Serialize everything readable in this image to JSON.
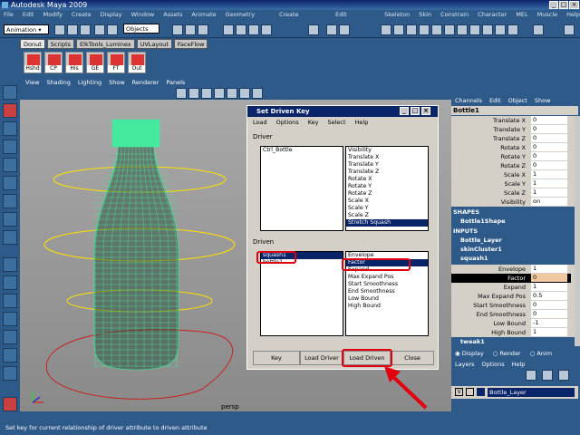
{
  "title": "Autodesk Maya 2009",
  "menubar": [
    "File",
    "Edit",
    "Modify",
    "Create",
    "Display",
    "Window",
    "Assets",
    "Animate",
    "Geometry Cache",
    "Create Deformers",
    "Edit Deformers",
    "Skeleton",
    "Skin",
    "Constrain",
    "Character",
    "MEL",
    "Muscle",
    "Help"
  ],
  "mode_select": "Animation",
  "objects_field": "Objects",
  "shelf_tabs": [
    "Donut",
    "Scripts",
    "ElkTools_Luminex",
    "UVLayout",
    "FaceFlow"
  ],
  "shelf_buttons": [
    "Hshd",
    "CP",
    "His",
    "GE",
    "FT",
    "Out"
  ],
  "panel_menu": [
    "View",
    "Shading",
    "Lighting",
    "Show",
    "Renderer",
    "Panels"
  ],
  "viewport": {
    "camera_label": "persp"
  },
  "dialog": {
    "title": "Set Driven Key",
    "menu": [
      "Load",
      "Options",
      "Key",
      "Select",
      "Help"
    ],
    "driver_label": "Driver",
    "driver_objects": [
      "Ctrl_Bottle"
    ],
    "driver_attributes": [
      "Visibility",
      "Translate X",
      "Translate Y",
      "Translate Z",
      "Rotate X",
      "Rotate Y",
      "Rotate Z",
      "Scale X",
      "Scale Y",
      "Scale Z",
      "Stretch Squash"
    ],
    "driver_selected": "Stretch Squash",
    "driven_label": "Driven",
    "driven_objects": [
      "squash1",
      "bottle1"
    ],
    "driven_selected_object": "squash1",
    "driven_attributes": [
      "Envelope",
      "Factor",
      "Expand",
      "Max Expand Pos",
      "Start Smoothness",
      "End Smoothness",
      "Low Bound",
      "High Bound"
    ],
    "driven_selected": "Factor",
    "buttons": {
      "key": "Key",
      "load_driver": "Load Driver",
      "load_driven": "Load Driven",
      "close": "Close"
    }
  },
  "channel_box": {
    "menu": [
      "Channels",
      "Edit",
      "Object",
      "Show"
    ],
    "object": "Bottle1",
    "channels": [
      {
        "name": "Translate X",
        "value": "0"
      },
      {
        "name": "Translate Y",
        "value": "0"
      },
      {
        "name": "Translate Z",
        "value": "0"
      },
      {
        "name": "Rotate X",
        "value": "0"
      },
      {
        "name": "Rotate Y",
        "value": "0"
      },
      {
        "name": "Rotate Z",
        "value": "0"
      },
      {
        "name": "Scale X",
        "value": "1"
      },
      {
        "name": "Scale Y",
        "value": "1"
      },
      {
        "name": "Scale Z",
        "value": "1"
      },
      {
        "name": "Visibility",
        "value": "on"
      }
    ],
    "shapes_label": "SHAPES",
    "shape": "Bottle1Shape",
    "inputs_label": "INPUTS",
    "inputs": [
      "Bottle_Layer",
      "skinCluster1",
      "squash1"
    ],
    "squash_channels": [
      {
        "name": "Envelope",
        "value": "1"
      },
      {
        "name": "Factor",
        "value": "0"
      },
      {
        "name": "Expand",
        "value": "1"
      },
      {
        "name": "Max Expand Pos",
        "value": "0.5"
      },
      {
        "name": "Start Smoothness",
        "value": "0"
      },
      {
        "name": "End Smoothness",
        "value": "0"
      },
      {
        "name": "Low Bound",
        "value": "-1"
      },
      {
        "name": "High Bound",
        "value": "1"
      }
    ],
    "tweak": "tweak1",
    "display_options": [
      "Display",
      "Render",
      "Anim"
    ],
    "layer_menu": [
      "Layers",
      "Options",
      "Help"
    ],
    "layer_v": "V",
    "layer_name": "Bottle_Layer"
  },
  "statusbar": "Set key for current relationship of driver attribute to driven attribute",
  "colors": {
    "ui_blue": "#2e5a8a",
    "title_blue": "#0a246a",
    "highlight_red": "#e00010",
    "wire_green": "#3cf0a0"
  }
}
